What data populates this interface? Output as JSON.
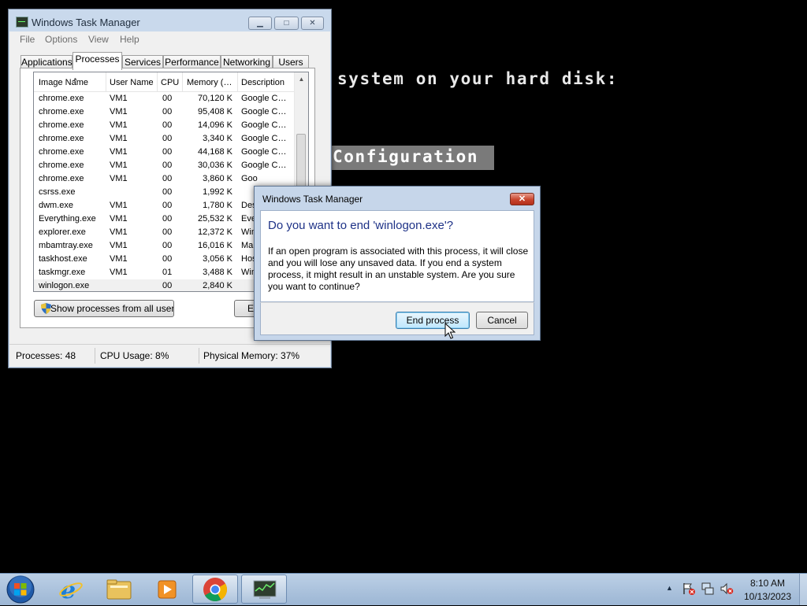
{
  "console": {
    "line1": "system on your hard disk:",
    "line2": "Configuration"
  },
  "task_manager": {
    "title": "Windows Task Manager",
    "window_controls": {
      "minimize": "▁",
      "maximize": "□",
      "close": "✕"
    },
    "menu": [
      "File",
      "Options",
      "View",
      "Help"
    ],
    "tabs": [
      "Applications",
      "Processes",
      "Services",
      "Performance",
      "Networking",
      "Users"
    ],
    "active_tab": "Processes",
    "columns": [
      "Image Name",
      "User Name",
      "CPU",
      "Memory (…",
      "Description"
    ],
    "processes": [
      {
        "name": "chrome.exe",
        "user": "VM1",
        "cpu": "00",
        "memory": "70,120 K",
        "desc": "Google C…"
      },
      {
        "name": "chrome.exe",
        "user": "VM1",
        "cpu": "00",
        "memory": "95,408 K",
        "desc": "Google C…"
      },
      {
        "name": "chrome.exe",
        "user": "VM1",
        "cpu": "00",
        "memory": "14,096 K",
        "desc": "Google C…"
      },
      {
        "name": "chrome.exe",
        "user": "VM1",
        "cpu": "00",
        "memory": "3,340 K",
        "desc": "Google C…"
      },
      {
        "name": "chrome.exe",
        "user": "VM1",
        "cpu": "00",
        "memory": "44,168 K",
        "desc": "Google C…"
      },
      {
        "name": "chrome.exe",
        "user": "VM1",
        "cpu": "00",
        "memory": "30,036 K",
        "desc": "Google C…"
      },
      {
        "name": "chrome.exe",
        "user": "VM1",
        "cpu": "00",
        "memory": "3,860 K",
        "desc": "Goo"
      },
      {
        "name": "csrss.exe",
        "user": "",
        "cpu": "00",
        "memory": "1,992 K",
        "desc": ""
      },
      {
        "name": "dwm.exe",
        "user": "VM1",
        "cpu": "00",
        "memory": "1,780 K",
        "desc": "Des"
      },
      {
        "name": "Everything.exe",
        "user": "VM1",
        "cpu": "00",
        "memory": "25,532 K",
        "desc": "Eve"
      },
      {
        "name": "explorer.exe",
        "user": "VM1",
        "cpu": "00",
        "memory": "12,372 K",
        "desc": "Win"
      },
      {
        "name": "mbamtray.exe",
        "user": "VM1",
        "cpu": "00",
        "memory": "16,016 K",
        "desc": "Mal"
      },
      {
        "name": "taskhost.exe",
        "user": "VM1",
        "cpu": "00",
        "memory": "3,056 K",
        "desc": "Hos"
      },
      {
        "name": "taskmgr.exe",
        "user": "VM1",
        "cpu": "01",
        "memory": "3,488 K",
        "desc": "Win"
      },
      {
        "name": "winlogon.exe",
        "user": "",
        "cpu": "00",
        "memory": "2,840 K",
        "desc": ""
      }
    ],
    "selected_process": "winlogon.exe",
    "show_all_button": "Show processes from all users",
    "end_process_button_partial": "E",
    "status": {
      "processes": "Processes: 48",
      "cpu_usage": "CPU Usage: 8%",
      "physical_memory": "Physical Memory: 37%"
    }
  },
  "dialog": {
    "title": "Windows Task Manager",
    "close": "✕",
    "heading": "Do you want to end 'winlogon.exe'?",
    "message": "If an open program is associated with this process, it will close and you will lose any unsaved data. If you end a system process, it might result in an unstable system. Are you sure you want to continue?",
    "confirm_button": "End process",
    "cancel_button": "Cancel"
  },
  "taskbar": {
    "pinned": [
      "internet-explorer-icon",
      "windows-explorer-icon",
      "media-player-icon",
      "chrome-icon",
      "task-manager-icon"
    ],
    "tray_expand": "▲",
    "clock_time": "8:10 AM",
    "clock_date": "10/13/2023"
  }
}
